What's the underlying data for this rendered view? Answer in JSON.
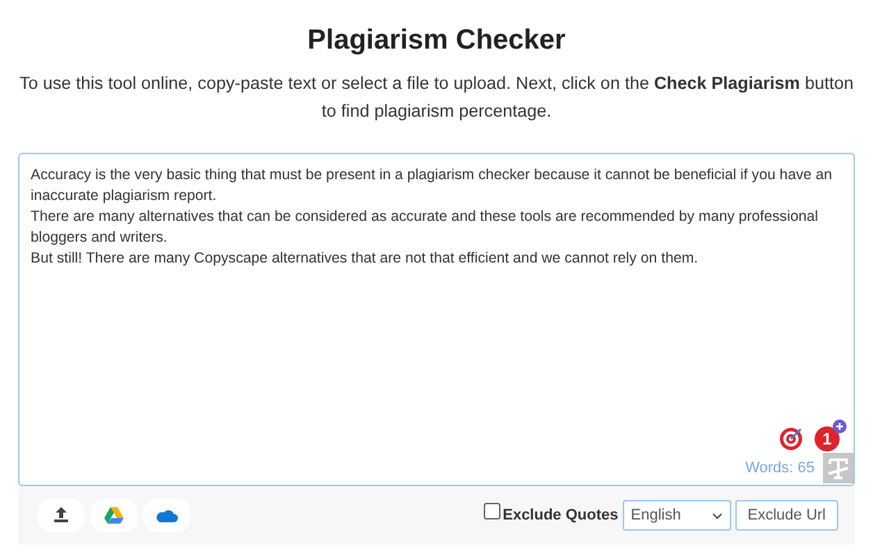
{
  "header": {
    "title": "Plagiarism Checker",
    "intro": "To use this tool online, copy-paste text or select a file to upload. Next, click on the **Check Plagiarism** button to find plagiarism percentage."
  },
  "editor": {
    "paragraphs": [
      "Accuracy is the very basic thing that must be present in a plagiarism checker because it cannot be beneficial if you have an inaccurate plagiarism report.",
      "There are many alternatives that can be considered as accurate and these tools are recommended by many professional bloggers and writers.",
      "But still! There are many Copyscape alternatives that are not that efficient and we cannot rely on them."
    ],
    "badge_count": "1",
    "word_count": "Words: 65"
  },
  "toolbar": {
    "sources": [
      {
        "kind": "upload"
      },
      {
        "kind": "drive"
      },
      {
        "kind": "cloud"
      }
    ],
    "exclude_quotes": {
      "label": "Exclude Quotes",
      "checked": false
    },
    "language": {
      "value": "English"
    },
    "exclude_url": "Exclude Url"
  }
}
